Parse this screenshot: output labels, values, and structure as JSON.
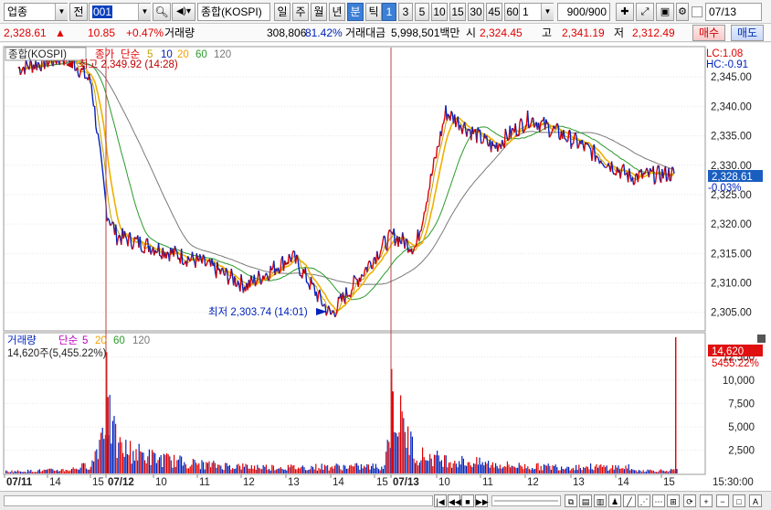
{
  "toolbar": {
    "market": "업종",
    "market_prefix": "전",
    "code": "001",
    "index_name": "종합(KOSPI)",
    "periods": [
      "일",
      "주",
      "월",
      "년",
      "분",
      "틱"
    ],
    "active_period": "분",
    "intervals": [
      "1",
      "3",
      "5",
      "10",
      "15",
      "30",
      "45",
      "60"
    ],
    "active_interval": "1",
    "interval_value": "1",
    "count": "900/900",
    "date": "07/13"
  },
  "info": {
    "price": "2,328.61",
    "change_arrow": "▲",
    "change": "10.85",
    "change_pct": "+0.47%",
    "volume_label": "거래량",
    "volume": "308,806",
    "volume_ratio": "81.42%",
    "amount_label": "거래대금",
    "amount": "5,998,501백만",
    "open_label": "시",
    "open": "2,324.45",
    "high_label": "고",
    "high": "2,341.19",
    "low_label": "저",
    "low": "2,312.49",
    "buy_label": "매수",
    "sell_label": "매도"
  },
  "price_panel": {
    "title": "종합(KOSPI)",
    "legend_close": "종가",
    "legend_ma": "단순",
    "ma_periods": [
      "5",
      "10",
      "20",
      "60",
      "120"
    ],
    "lc": "LC:1.08",
    "hc": "HC:-0.91",
    "max_label": "최고 2,349.92 (14:28)",
    "min_label": "최저 2,303.74 (14:01)",
    "current_price": "2,328.61",
    "current_pct": "-0.03%",
    "y_ticks": [
      "2,345.00",
      "2,340.00",
      "2,335.00",
      "2,330.00",
      "2,325.00",
      "2,320.00",
      "2,315.00",
      "2,310.00",
      "2,305.00"
    ]
  },
  "volume_panel": {
    "title": "거래량",
    "legend_ma": "단순",
    "ma_periods": [
      "5",
      "20",
      "60",
      "120"
    ],
    "summary": "14,620주(5,455.22%)",
    "current_volume": "14,620",
    "current_pct": "5455.22%",
    "y_ticks": [
      "12,500",
      "10,000",
      "7,500",
      "5,000",
      "2,500"
    ]
  },
  "x_axis": {
    "labels": [
      "07/11",
      "14",
      "15",
      "07/12",
      "10",
      "11",
      "12",
      "13",
      "14",
      "15",
      "07/13",
      "10",
      "11",
      "12",
      "13",
      "14",
      "15"
    ],
    "end_time": "15:30:00"
  },
  "colors": {
    "up": "#e00000",
    "down": "#0022bb",
    "ma5": "#c0a000",
    "ma10": "#f0b000",
    "ma20": "#2a9a2a",
    "ma60": "#6a6a6a",
    "accent": "#3d7fd6"
  },
  "chart_data": {
    "type": "line",
    "x": [
      "07/11 14:00",
      "07/11 14:28",
      "07/11 15:00",
      "07/12 09:05",
      "07/12 09:30",
      "07/12 10:00",
      "07/12 11:00",
      "07/12 12:00",
      "07/12 13:00",
      "07/12 14:00",
      "07/12 15:00",
      "07/13 09:05",
      "07/13 09:30",
      "07/13 10:00",
      "07/13 11:00",
      "07/13 12:00",
      "07/13 13:00",
      "07/13 14:00",
      "07/13 15:00"
    ],
    "series": [
      {
        "name": "종가",
        "values": [
          2346.5,
          2348.5,
          2344.0,
          2322.0,
          2318.0,
          2316.0,
          2313.5,
          2309.5,
          2314.5,
          2304.5,
          2316.5,
          2318.0,
          2316.0,
          2339.0,
          2333.0,
          2338.0,
          2334.0,
          2328.0,
          2328.6
        ]
      }
    ],
    "volume": [
      300,
      500,
      1200,
      8000,
      3500,
      2000,
      1200,
      900,
      800,
      900,
      900,
      9000,
      2500,
      1800,
      1200,
      900,
      900,
      800,
      14620
    ],
    "ylim": [
      2302,
      2350
    ],
    "volume_ylim": [
      0,
      15000
    ]
  }
}
